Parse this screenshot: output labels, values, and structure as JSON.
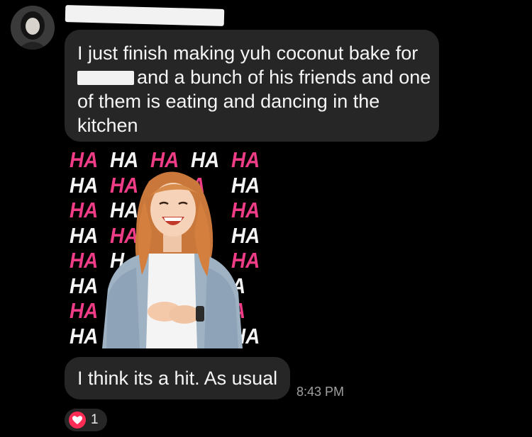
{
  "thread": {
    "message_1": "I just finish making yuh coconut bake for",
    "message_1_cont": "and a bunch of his friends and one of them is eating and dancing in the kitchen",
    "message_2": "I think its a hit. As usual",
    "timestamp": "8:43 PM",
    "reaction": {
      "icon": "heart-icon",
      "count": "1",
      "color": "#ff2d55"
    }
  },
  "sticker": {
    "rows": [
      [
        "HA",
        "HA",
        "HA",
        "HA",
        "HA"
      ],
      [
        "HA",
        "HA",
        "H",
        "A",
        "HA"
      ],
      [
        "HA",
        "HA",
        "H",
        "A",
        "HA"
      ],
      [
        "HA",
        "HA",
        "",
        "",
        "HA"
      ],
      [
        "HA",
        "H",
        "",
        "",
        "HA"
      ],
      [
        "HA",
        "",
        "",
        "",
        "A"
      ],
      [
        "HA",
        "",
        "",
        "",
        "A"
      ],
      [
        "HA",
        "H",
        "",
        "A",
        "HA"
      ]
    ],
    "colors": {
      "white": "#f4f4f4",
      "pink": "#ee3d86"
    }
  }
}
